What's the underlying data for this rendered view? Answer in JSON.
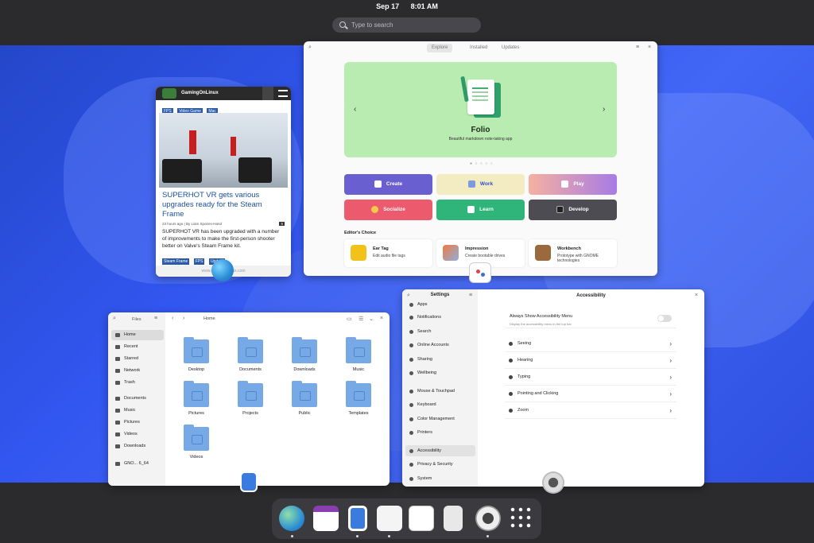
{
  "topbar": {
    "date": "Sep 17",
    "time": "8:01 AM",
    "search_placeholder": "Type to search"
  },
  "gol": {
    "site": "GamingOnLinux",
    "tags_top": [
      "FPS",
      "Video Game",
      "Mac"
    ],
    "headline": "SUPERHOT VR gets various upgrades ready for the Steam Frame",
    "meta": "23 hours ago | By Liam Spoires-Hand",
    "comments": "6",
    "body": "SUPERHOT VR has been upgraded with a number of improvements to make the first-person shooter better on Valve's Steam Frame kit.",
    "tags_bottom": [
      "Steam Frame",
      "FPS",
      "Update"
    ],
    "url": "www.gamingonlinux.com"
  },
  "software": {
    "tabs": [
      "Explore",
      "Installed",
      "Updates"
    ],
    "featured_name": "Folio",
    "featured_desc": "Beautiful markdown note-taking app",
    "categories": [
      "Create",
      "Work",
      "Play",
      "Socialize",
      "Learn",
      "Develop"
    ],
    "editors_choice": "Editor's Choice",
    "cards": [
      {
        "name": "Ear Tag",
        "desc": "Edit audio file tags"
      },
      {
        "name": "Impression",
        "desc": "Create bootable drives"
      },
      {
        "name": "Workbench",
        "desc": "Prototype with GNOME technologies"
      }
    ],
    "colors": {
      "create": "#6a5fd0",
      "work": "#f3ecc2",
      "play": "#e879b0",
      "socialize": "#ec5a6e",
      "learn": "#2fb57a",
      "develop": "#4c4c52"
    }
  },
  "files": {
    "title": "Files",
    "path": "Home",
    "sidebar": [
      "Home",
      "Recent",
      "Starred",
      "Network",
      "Trash",
      "Documents",
      "Music",
      "Pictures",
      "Videos",
      "Downloads",
      "GNO... 6_64"
    ],
    "folders": [
      "Desktop",
      "Documents",
      "Downloads",
      "Music",
      "Pictures",
      "Projects",
      "Public",
      "Templates",
      "Videos"
    ]
  },
  "settings": {
    "title": "Settings",
    "sidebar": [
      "Apps",
      "Notifications",
      "Search",
      "Online Accounts",
      "Sharing",
      "Wellbeing",
      "Mouse & Touchpad",
      "Keyboard",
      "Color Management",
      "Printers",
      "Accessibility",
      "Privacy & Security",
      "System"
    ],
    "panel_title": "Accessibility",
    "toggle_label": "Always Show Accessibility Menu",
    "toggle_sub": "Display the accessibility menu in the top bar",
    "rows": [
      "Seeing",
      "Hearing",
      "Typing",
      "Pointing and Clicking",
      "Zoom"
    ]
  },
  "dock": {
    "apps": [
      "web-browser-icon",
      "calendar-icon",
      "files-icon",
      "software-icon",
      "text-editor-icon",
      "calculator-icon",
      "settings-icon",
      "app-grid-icon"
    ]
  }
}
